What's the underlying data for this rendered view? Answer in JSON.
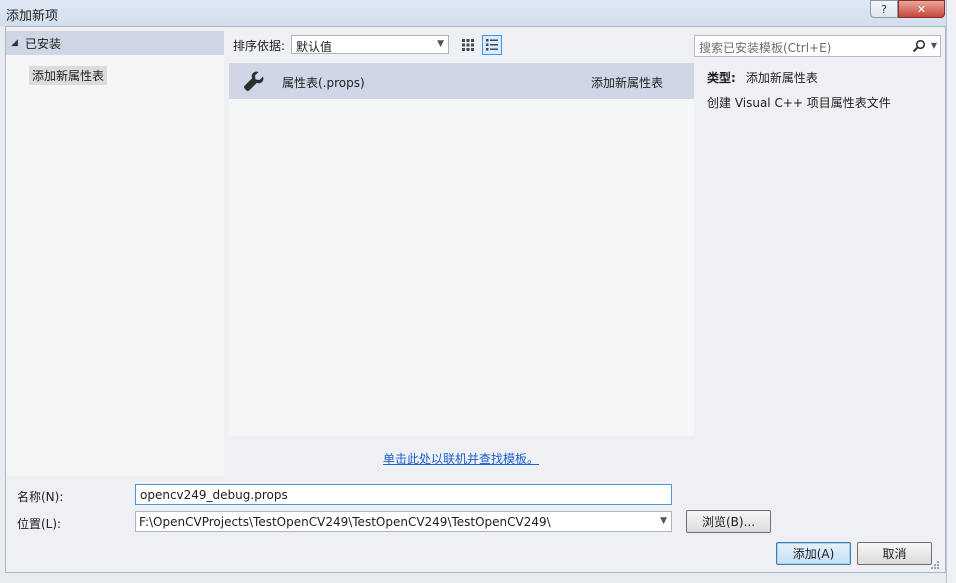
{
  "window": {
    "title": "添加新项",
    "help_label": "?",
    "close_label": "✕"
  },
  "left_panel": {
    "header": "已安装",
    "items": [
      {
        "label": "添加新属性表",
        "selected": true
      }
    ]
  },
  "toolbar": {
    "sort_label": "排序依据:",
    "sort_value": "默认值",
    "view_mode": "list"
  },
  "search": {
    "placeholder": "搜索已安装模板(Ctrl+E)"
  },
  "templates": [
    {
      "name": "属性表(.props)",
      "category": "添加新属性表",
      "icon": "wrench-icon",
      "selected": true
    }
  ],
  "detail": {
    "type_label": "类型:",
    "type_value": "添加新属性表",
    "description": "创建 Visual C++ 项目属性表文件"
  },
  "online_link": "单击此处以联机并查找模板。",
  "form": {
    "name_label": "名称(N):",
    "name_value": "opencv249_debug.props",
    "location_label": "位置(L):",
    "location_value": "F:\\OpenCVProjects\\TestOpenCV249\\TestOpenCV249\\TestOpenCV249\\",
    "browse_label": "浏览(B)..."
  },
  "buttons": {
    "add_label": "添加(A)",
    "cancel_label": "取消"
  },
  "colors": {
    "selection_bg": "#cfd6e5",
    "link": "#1a5fd0",
    "focus_border": "#4f93d6"
  }
}
